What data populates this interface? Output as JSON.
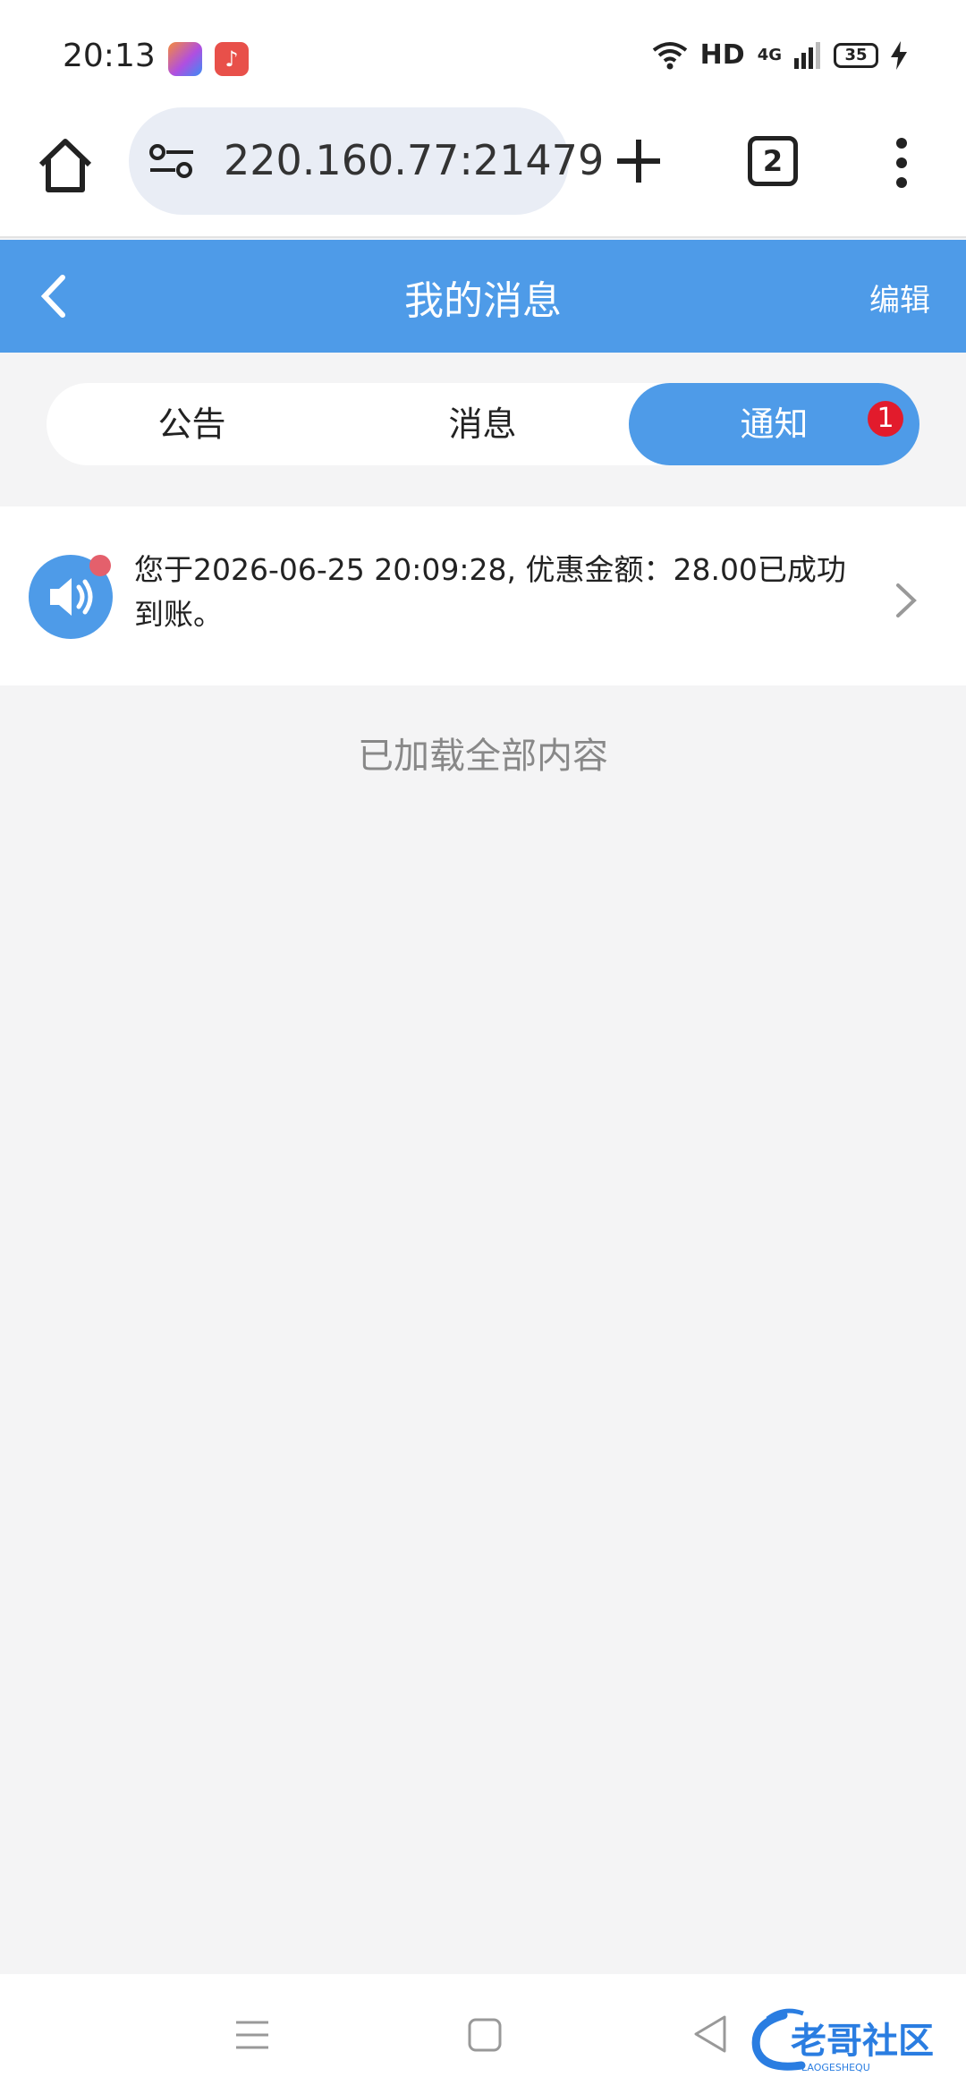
{
  "status_bar": {
    "time": "20:13",
    "network_hd": "HD",
    "network_gen": "4G",
    "battery": "35"
  },
  "browser": {
    "url": "220.160.77:21479",
    "tab_count": "2"
  },
  "header": {
    "title": "我的消息",
    "edit_label": "编辑"
  },
  "segments": {
    "items": [
      {
        "label": "公告"
      },
      {
        "label": "消息"
      },
      {
        "label": "通知"
      }
    ],
    "active_index": 2,
    "badge": "1"
  },
  "messages": [
    {
      "text": "您于2026-06-25 20:09:28, 优惠金额：28.00已成功到账。",
      "unread": true
    }
  ],
  "footer_text": "已加载全部内容",
  "watermark": {
    "main": "老哥社区",
    "sub": "LAOGESHEQU"
  },
  "colors": {
    "primary": "#4e9be8",
    "badge": "#e21b2c",
    "unread_dot": "#e4606c"
  }
}
